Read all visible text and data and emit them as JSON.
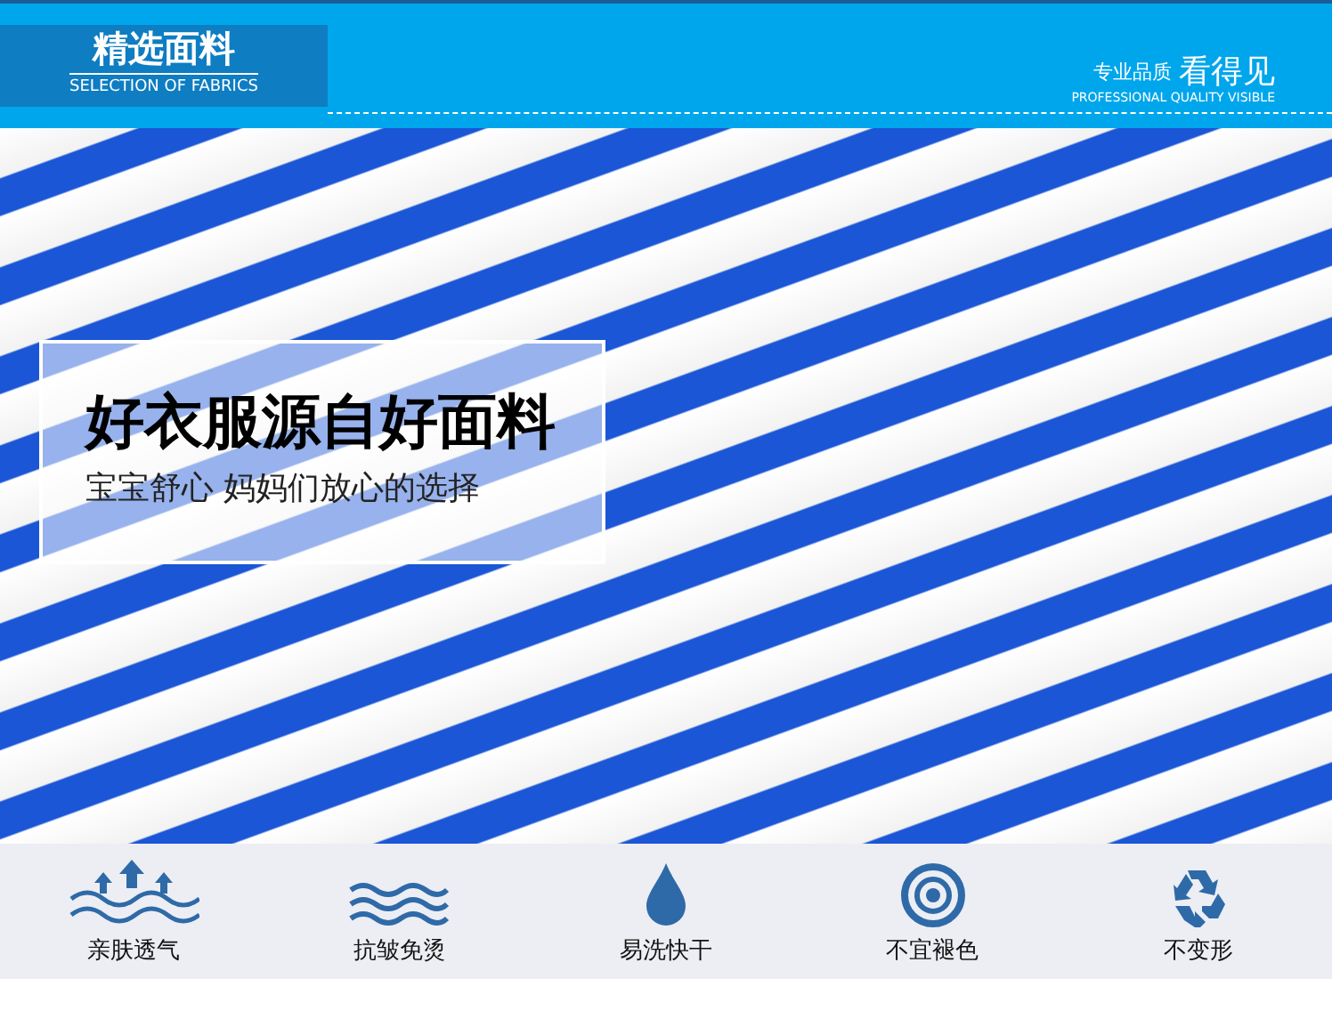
{
  "header": {
    "title": "精选面料",
    "subtitle": "SELECTION OF FABRICS",
    "tagline_small": "专业品质",
    "tagline_large": "看得见",
    "tagline_en": "PROFESSIONAL QUALITY VISIBLE"
  },
  "banner": {
    "headline": "好衣服源自好面料",
    "subline": "宝宝舒心 妈妈们放心的选择"
  },
  "features": [
    {
      "kind": "breathable",
      "label": "亲肤透气"
    },
    {
      "kind": "waves",
      "label": "抗皱免烫"
    },
    {
      "kind": "drop",
      "label": "易洗快干"
    },
    {
      "kind": "target",
      "label": "不宜褪色"
    },
    {
      "kind": "recycle",
      "label": "不变形"
    }
  ]
}
